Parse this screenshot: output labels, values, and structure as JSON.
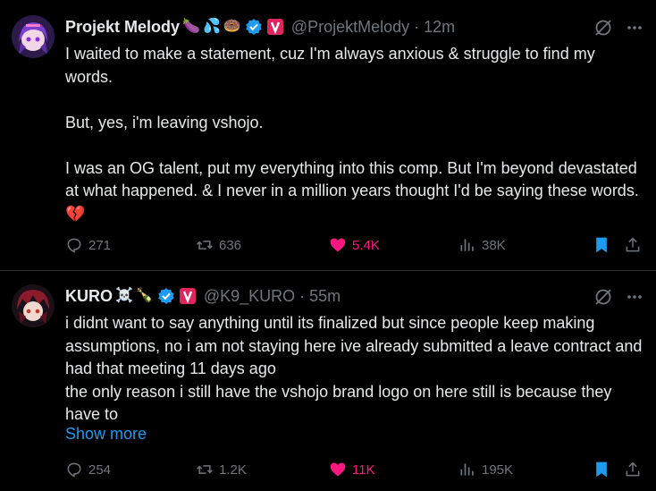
{
  "tweets": [
    {
      "name": "Projekt Melody",
      "name_emojis": [
        "🍆",
        "💦",
        "🍩"
      ],
      "handle": "@ProjektMelody",
      "dot": "·",
      "time": "12m",
      "paragraphs": [
        "I waited to make a statement, cuz I'm always anxious & struggle to find my words.",
        "But, yes, i'm leaving vshojo.",
        "I was an OG talent, put my everything into this comp. But I'm beyond devastated at what happened. & I never in a million years thought I'd be saying these words. 💔"
      ],
      "stats": {
        "replies": "271",
        "reposts": "636",
        "likes": "5.4K",
        "views": "38K"
      }
    },
    {
      "name": "KURO",
      "name_emojis": [
        "☠️",
        "🍾"
      ],
      "handle": "@K9_KURO",
      "dot": "·",
      "time": "55m",
      "paragraphs": [
        "i didnt want to say anything until its finalized but since people keep making assumptions, no i am not staying here ive already submitted a leave contract and had that meeting 11 days ago",
        "the only reason i still have the vshojo brand logo on here still is because they have to"
      ],
      "show_more": "Show more",
      "stats": {
        "replies": "254",
        "reposts": "1.2K",
        "likes": "11K",
        "views": "195K"
      }
    }
  ],
  "colors": {
    "background": "#000000",
    "text": "#e7e9ea",
    "muted": "#71767b",
    "link": "#1d9bf0",
    "like": "#f91880",
    "verified": "#1d9bf0",
    "vshojo_badge": "#e0245e",
    "divider": "#2f3336"
  },
  "icons": [
    "grok-icon",
    "more-icon",
    "reply-icon",
    "repost-icon",
    "like-icon",
    "views-icon",
    "bookmark-icon",
    "share-icon",
    "verified-badge-icon",
    "vshojo-affiliate-badge"
  ]
}
